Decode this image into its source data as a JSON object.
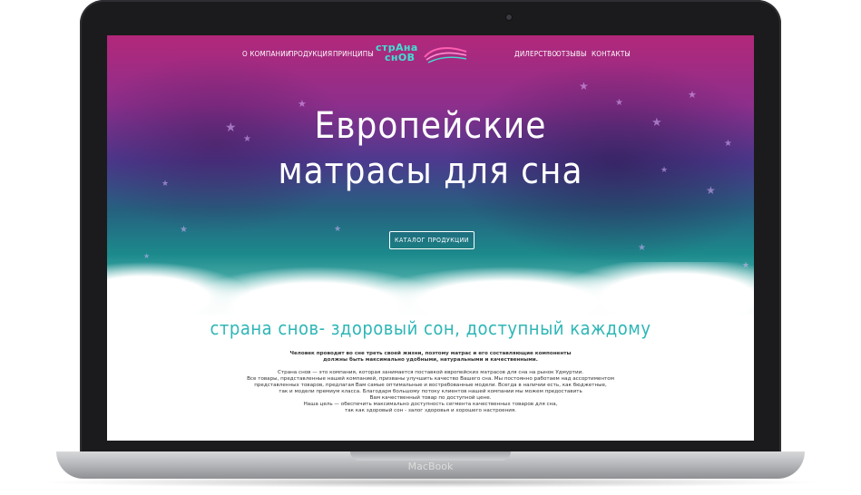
{
  "device": {
    "brand_label": "MacBook"
  },
  "nav": {
    "left": [
      "О КОМПАНИИ",
      "ПРОДУКЦИЯ",
      "ПРИНЦИПЫ"
    ],
    "right": [
      "ДИЛЕРСТВО",
      "ОТЗЫВЫ",
      "КОНТАКТЫ"
    ]
  },
  "logo": {
    "line1": "стрАна",
    "line2": "снОВ"
  },
  "hero": {
    "title_line1": "Европейские",
    "title_line2": "матрасы для сна",
    "button_label": "КАТАЛОГ ПРОДУКЦИИ"
  },
  "about": {
    "heading": "страна снов- здоровый сон, доступный каждому",
    "intro_lines": [
      "Человек проводит во сне треть своей жизни, поэтому матрас и его составляющие компоненты",
      "должны быть максимально удобными, натуральными и качественными."
    ],
    "paragraph_lines": [
      "Страна снов — это компания, которая занимается поставкой европейских матрасов для сна на рынок Удмуртии.",
      "Все товары, представленные нашей компанией, призваны улучшить качество Вашего сна. Мы постоянно работаем над ассортиментом",
      "представленных товаров, предлагая Вам самые оптимальные и востребованные модели. Всегда в наличии есть, как бюджетные,",
      "так и модели премиум класса. Благодаря большому потоку клиентов нашей компании мы можем предоставить",
      "Вам качественный товар по доступной цене."
    ],
    "goal_lines": [
      "Наша цель — обеспечить максимально доступность сегмента качественных товаров для сна,",
      "так как здоровый сон - залог здоровья и хорошего настроения."
    ]
  },
  "colors": {
    "accent": "#2fb6b6",
    "hero_top": "#b2287a",
    "hero_mid": "#4b3a8e",
    "hero_bottom": "#1c8a8c"
  }
}
